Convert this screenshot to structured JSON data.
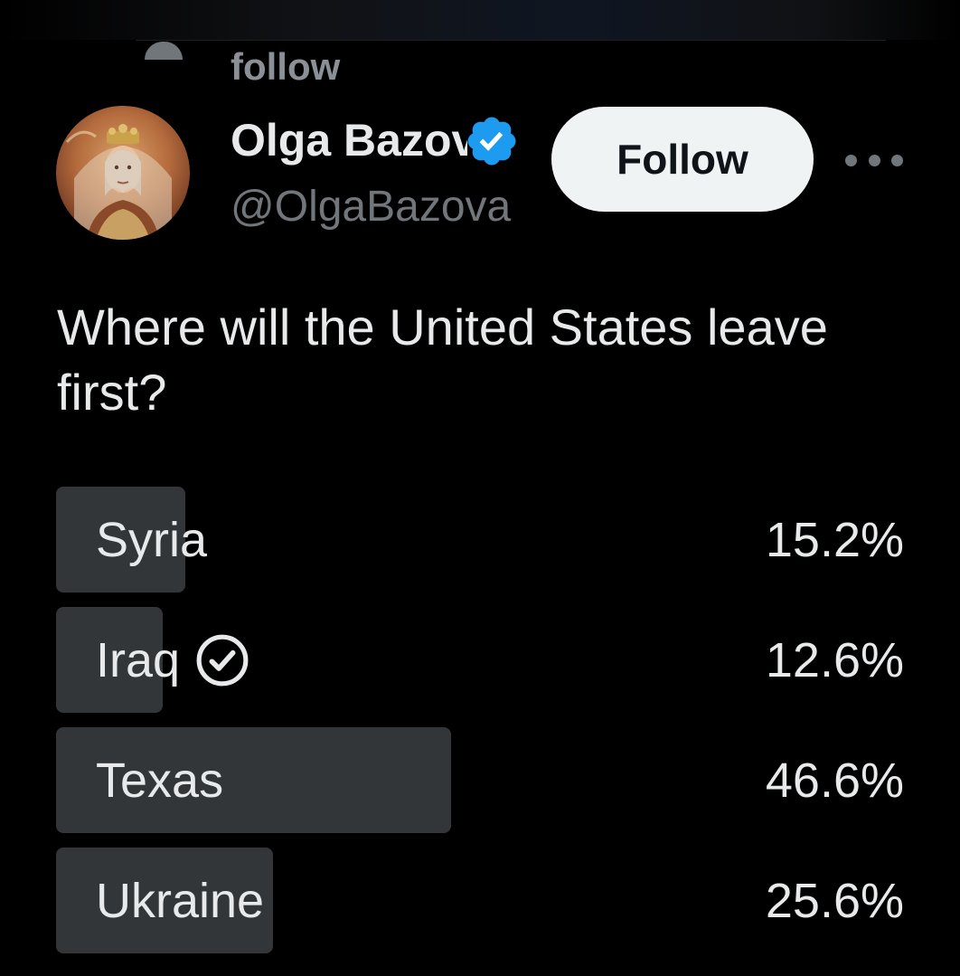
{
  "header": {
    "context_label": "follow"
  },
  "author": {
    "display_name": "Olga Bazova",
    "handle": "@OlgaBazova",
    "verified": true,
    "avatar_icon": "avatar-portrait",
    "follow_label": "Follow",
    "more_icon": "more-horizontal-icon"
  },
  "tweet": {
    "question": "Where will the United States leave first?"
  },
  "poll": {
    "options": [
      {
        "label": "Syria",
        "percent_text": "15.2%",
        "percent": 15.2,
        "selected": false
      },
      {
        "label": "Iraq",
        "percent_text": "12.6%",
        "percent": 12.6,
        "selected": true
      },
      {
        "label": "Texas",
        "percent_text": "46.6%",
        "percent": 46.6,
        "selected": false
      },
      {
        "label": "Ukraine",
        "percent_text": "25.6%",
        "percent": 25.6,
        "selected": false
      }
    ]
  },
  "colors": {
    "background": "#000000",
    "text_primary": "#e7e9ea",
    "text_secondary": "#71767b",
    "poll_bar": "#333639",
    "verified_blue": "#1d9bf0",
    "follow_button_bg": "#eff3f4"
  }
}
